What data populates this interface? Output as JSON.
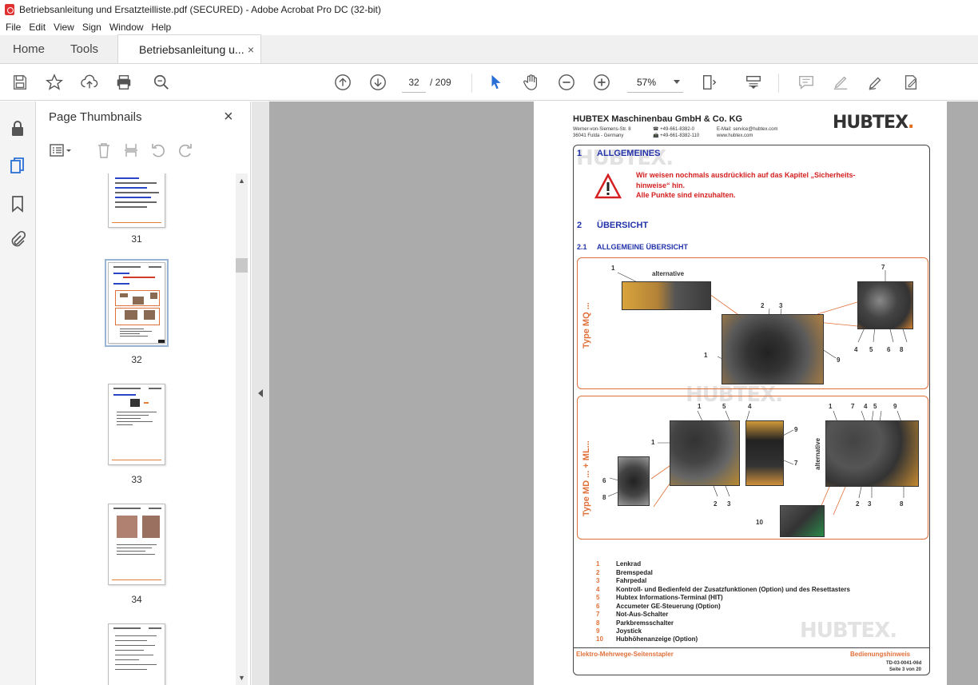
{
  "window": {
    "title": "Betriebsanleitung und Ersatzteilliste.pdf (SECURED) - Adobe Acrobat Pro DC (32-bit)"
  },
  "menu": [
    "File",
    "Edit",
    "View",
    "Sign",
    "Window",
    "Help"
  ],
  "tabs": {
    "home": "Home",
    "tools": "Tools",
    "document": "Betriebsanleitung u...",
    "close": "×"
  },
  "toolbar": {
    "current_page": "32",
    "page_total": "/ 209",
    "zoom": "57%"
  },
  "thumbnails": {
    "title": "Page Thumbnails",
    "close": "×",
    "pages": [
      {
        "label": "31",
        "selected": false
      },
      {
        "label": "32",
        "selected": true
      },
      {
        "label": "33",
        "selected": false
      },
      {
        "label": "34",
        "selected": false
      }
    ]
  },
  "document": {
    "company": "HUBTEX Maschinenbau GmbH & Co. KG",
    "address1": "Werner-von-Siemens-Str. 8",
    "address2": "36041 Fulda - Germany",
    "phone1": "☎ +49-661-8382-0",
    "phone2": "📠 +49-661-8382-110",
    "email": "E-Mail: service@hubtex.com",
    "web": "www.hubtex.com",
    "logo_text": "HUBTEX",
    "logo_dot": ".",
    "watermark": "HUBTEX.",
    "section1_num": "1",
    "section1_title": "ALLGEMEINES",
    "warning_line1": "Wir weisen nochmals ausdrücklich auf das Kapitel „Sicherheits-",
    "warning_line2": "hinweise“ hin.",
    "warning_line3": "Alle Punkte sind einzuhalten.",
    "section2_num": "2",
    "section2_title": "ÜBERSICHT",
    "section21_num": "2.1",
    "section21_title": "ALLGEMEINE ÜBERSICHT",
    "box1_label": "Type MQ ...",
    "box2_label": "Type MD ...  +  ML...",
    "alternative": "alternative",
    "legend": [
      {
        "n": "1",
        "t": "Lenkrad"
      },
      {
        "n": "2",
        "t": "Bremspedal"
      },
      {
        "n": "3",
        "t": "Fahrpedal"
      },
      {
        "n": "4",
        "t": "Kontroll- und Bedienfeld der Zusatzfunktionen (Option) und des Resettasters"
      },
      {
        "n": "5",
        "t": "Hubtex Informations-Terminal (HIT)"
      },
      {
        "n": "6",
        "t": "Accumeter GE-Steuerung (Option)"
      },
      {
        "n": "7",
        "t": "Not-Aus-Schalter"
      },
      {
        "n": "8",
        "t": "Parkbremsschalter"
      },
      {
        "n": "9",
        "t": "Joystick"
      },
      {
        "n": "10",
        "t": "Hubhöhenanzeige (Option)"
      }
    ],
    "footer_left": "Elektro-Mehrwege-Seitenstapler",
    "footer_right": "Bedienungshinweis",
    "footer_code": "TD-03-0041-06d",
    "footer_page": "Seite 3 von 20"
  },
  "colors": {
    "accent_orange": "#e0703a",
    "section_blue": "#2233aa",
    "warning_red": "#d42020"
  }
}
